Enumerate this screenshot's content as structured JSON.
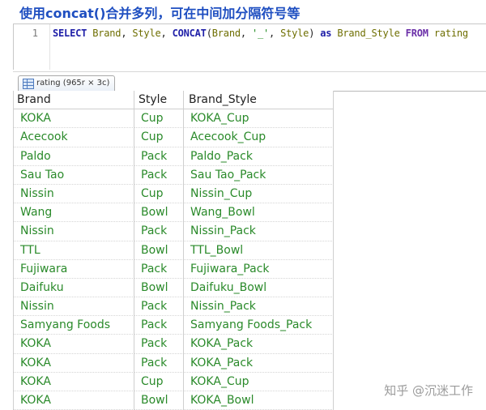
{
  "title": "使用concat()合并多列，可在中间加分隔符号等",
  "editor": {
    "line_number": "1",
    "tokens": {
      "select": "SELECT",
      "brand": "Brand",
      "comma1": ", ",
      "style": "Style",
      "comma2": ", ",
      "concat": "CONCAT",
      "paren_open": "(",
      "brand2": "Brand",
      "comma3": ", ",
      "sep": "'_'",
      "comma4": ", ",
      "style2": "Style",
      "paren_close": ")",
      "as": "as",
      "alias": "Brand_Style",
      "from": "FROM",
      "table": "rating"
    }
  },
  "result_tab": {
    "label": "rating (965r × 3c)"
  },
  "grid": {
    "columns": [
      "Brand",
      "Style",
      "Brand_Style"
    ],
    "rows": [
      [
        "KOKA",
        "Cup",
        "KOKA_Cup"
      ],
      [
        "Acecook",
        "Cup",
        "Acecook_Cup"
      ],
      [
        "Paldo",
        "Pack",
        "Paldo_Pack"
      ],
      [
        "Sau Tao",
        "Pack",
        "Sau Tao_Pack"
      ],
      [
        "Nissin",
        "Cup",
        "Nissin_Cup"
      ],
      [
        "Wang",
        "Bowl",
        "Wang_Bowl"
      ],
      [
        "Nissin",
        "Pack",
        "Nissin_Pack"
      ],
      [
        "TTL",
        "Bowl",
        "TTL_Bowl"
      ],
      [
        "Fujiwara",
        "Pack",
        "Fujiwara_Pack"
      ],
      [
        "Daifuku",
        "Bowl",
        "Daifuku_Bowl"
      ],
      [
        "Nissin",
        "Pack",
        "Nissin_Pack"
      ],
      [
        "Samyang Foods",
        "Pack",
        "Samyang Foods_Pack"
      ],
      [
        "KOKA",
        "Pack",
        "KOKA_Pack"
      ],
      [
        "KOKA",
        "Pack",
        "KOKA_Pack"
      ],
      [
        "KOKA",
        "Cup",
        "KOKA_Cup"
      ],
      [
        "KOKA",
        "Bowl",
        "KOKA_Bowl"
      ]
    ]
  },
  "watermark": "知乎 @沉迷工作",
  "colors": {
    "title": "#1f4fc1",
    "cell_text": "#2a8a2a",
    "keyword": "#1f1fa8"
  }
}
